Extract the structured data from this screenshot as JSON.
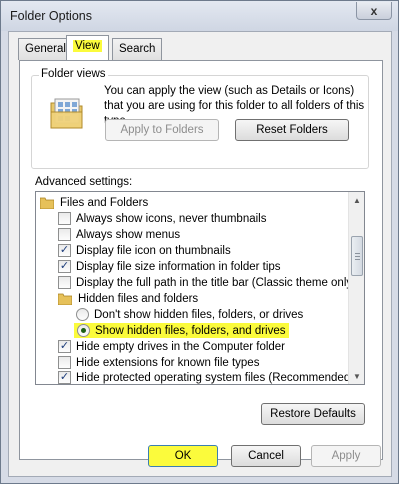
{
  "window": {
    "title": "Folder Options",
    "close_label": "x"
  },
  "tabs": [
    {
      "label": "General",
      "active": false
    },
    {
      "label": "View",
      "active": true
    },
    {
      "label": "Search",
      "active": false
    }
  ],
  "folder_views": {
    "legend": "Folder views",
    "description": "You can apply the view (such as Details or Icons) that you are using for this folder to all folders of this type.",
    "apply_button": "Apply to Folders",
    "reset_button": "Reset Folders",
    "icon": "folder-views-icon"
  },
  "advanced": {
    "label": "Advanced settings:",
    "items": [
      {
        "type": "folder",
        "label": "Files and Folders",
        "level": 0,
        "icon": "folder-icon"
      },
      {
        "type": "checkbox",
        "label": "Always show icons, never thumbnails",
        "checked": false,
        "level": 1
      },
      {
        "type": "checkbox",
        "label": "Always show menus",
        "checked": false,
        "level": 1
      },
      {
        "type": "checkbox",
        "label": "Display file icon on thumbnails",
        "checked": true,
        "level": 1
      },
      {
        "type": "checkbox",
        "label": "Display file size information in folder tips",
        "checked": true,
        "level": 1
      },
      {
        "type": "checkbox",
        "label": "Display the full path in the title bar (Classic theme only)",
        "checked": false,
        "level": 1
      },
      {
        "type": "folder",
        "label": "Hidden files and folders",
        "level": 1,
        "icon": "folder-icon"
      },
      {
        "type": "radio",
        "label": "Don't show hidden files, folders, or drives",
        "checked": false,
        "level": 2
      },
      {
        "type": "radio",
        "label": "Show hidden files, folders, and drives",
        "checked": true,
        "level": 2,
        "highlight": true
      },
      {
        "type": "checkbox",
        "label": "Hide empty drives in the Computer folder",
        "checked": true,
        "level": 1
      },
      {
        "type": "checkbox",
        "label": "Hide extensions for known file types",
        "checked": false,
        "level": 1
      },
      {
        "type": "checkbox",
        "label": "Hide protected operating system files (Recommended)",
        "checked": true,
        "level": 1
      }
    ]
  },
  "restore_defaults_button": "Restore Defaults",
  "footer": {
    "ok": "OK",
    "cancel": "Cancel",
    "apply": "Apply"
  },
  "colors": {
    "highlight": "#fbfb3c",
    "window_frame": "#d6dbe6"
  }
}
